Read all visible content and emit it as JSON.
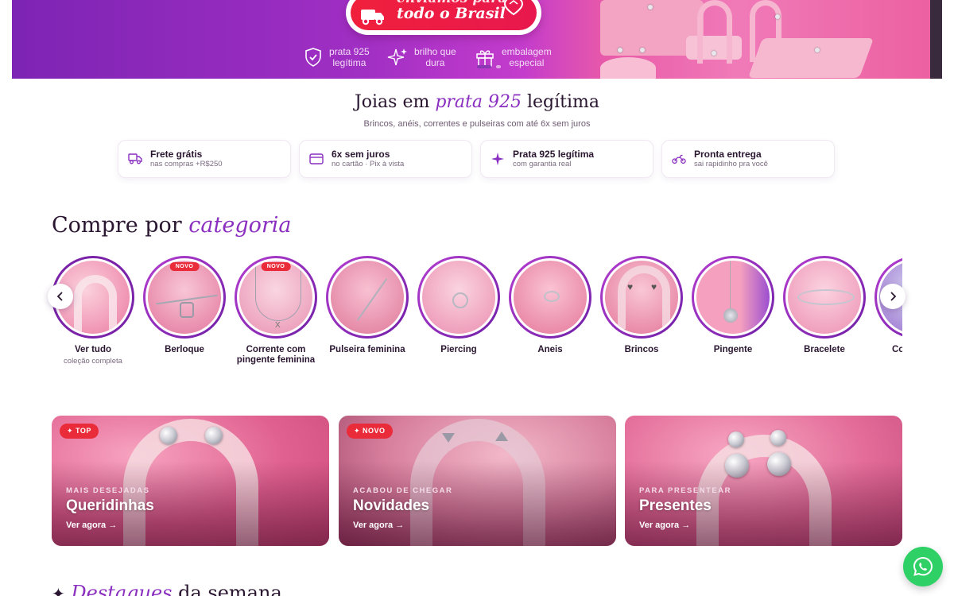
{
  "hero": {
    "ship_line1": "enviamos para",
    "ship_line2": "todo o Brasil",
    "perks": [
      {
        "label_a": "prata 925",
        "label_b": "legítima"
      },
      {
        "label_a": "brilho que",
        "label_b": "dura"
      },
      {
        "label_a": "embalagem",
        "label_b": "especial"
      }
    ]
  },
  "headline": {
    "pre": "Joias em ",
    "accent": "prata 925",
    "post": " legítima",
    "subtitle": "Brincos, anéis, correntes e pulseiras com até 6x sem juros"
  },
  "benefits": [
    {
      "title": "Frete grátis",
      "sub": "nas compras +R$250",
      "icon": "truck-icon"
    },
    {
      "title": "6x sem juros",
      "sub": "no cartão · Pix à vista",
      "icon": "card-icon"
    },
    {
      "title": "Prata 925 legítima",
      "sub": "com garantia real",
      "icon": "sparkle-icon"
    },
    {
      "title": "Pronta entrega",
      "sub": "sai rapidinho pra você",
      "icon": "motorbike-icon"
    }
  ],
  "categories_section": {
    "pre": "Compre por ",
    "accent": "categoria",
    "items": [
      {
        "name": "Ver tudo",
        "sub": "coleção completa"
      },
      {
        "name": "Berloque",
        "badge": "NOVO"
      },
      {
        "name": "Corrente com pingente feminina",
        "badge": "NOVO"
      },
      {
        "name": "Pulseira feminina"
      },
      {
        "name": "Piercing"
      },
      {
        "name": "Aneis"
      },
      {
        "name": "Brincos"
      },
      {
        "name": "Pingente"
      },
      {
        "name": "Bracelete"
      },
      {
        "name": "Co"
      }
    ]
  },
  "promos": [
    {
      "tag": "✦ TOP",
      "kicker": "MAIS DESEJADAS",
      "title": "Queridinhas",
      "cta": "Ver agora →"
    },
    {
      "tag": "✦ NOVO",
      "kicker": "ACABOU DE CHEGAR",
      "title": "Novidades",
      "cta": "Ver agora →"
    },
    {
      "tag": "",
      "kicker": "PARA PRESENTEAR",
      "title": "Presentes",
      "cta": "Ver agora →"
    }
  ],
  "bottom": {
    "pre": "Destaques",
    "post": " da semana"
  },
  "colors": {
    "accent": "#8a2fc0",
    "badge_red": "#ea2b3a",
    "whatsapp": "#2fd166"
  }
}
